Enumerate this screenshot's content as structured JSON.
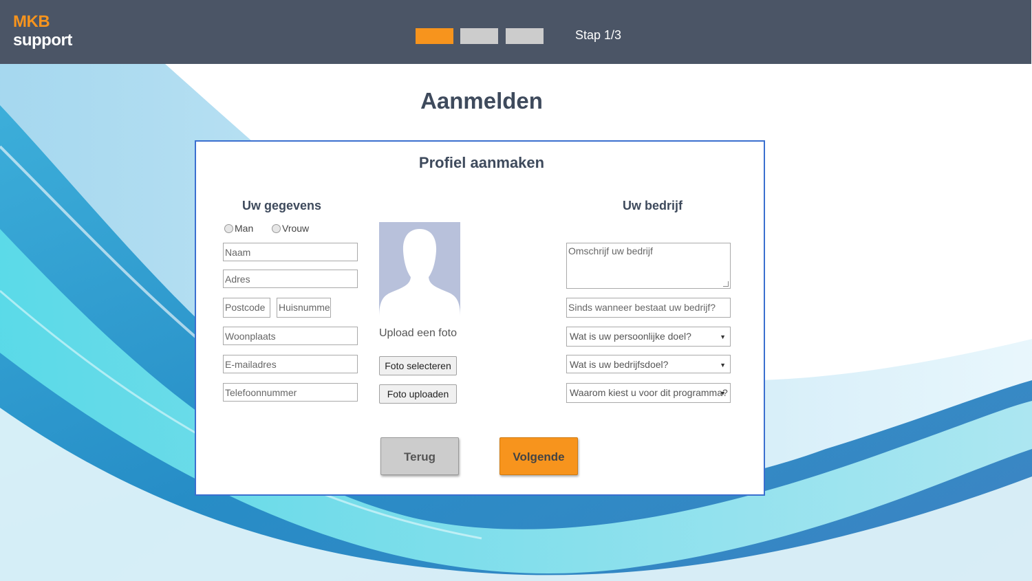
{
  "header": {
    "logo_line1": "MKB",
    "logo_line2": "support",
    "progress": {
      "current_step": 1,
      "total_steps": 3
    },
    "step_label": "Stap 1/3"
  },
  "page_title": "Aanmelden",
  "form": {
    "title": "Profiel aanmaken",
    "personal": {
      "title": "Uw gegevens",
      "gender_options": [
        "Man",
        "Vrouw"
      ],
      "fields": {
        "name": "Naam",
        "address": "Adres",
        "postcode": "Postcode",
        "house_number": "Huisnummer",
        "city": "Woonplaats",
        "email": "E-mailadres",
        "phone": "Telefoonnummer"
      }
    },
    "photo": {
      "upload_label": "Upload een foto",
      "select_button": "Foto selecteren",
      "upload_button": "Foto uploaden"
    },
    "company": {
      "title": "Uw bedrijf",
      "description": "Omschrijf uw bedrijf",
      "since": "Sinds wanneer bestaat uw bedrijf?",
      "personal_goal": "Wat is uw persoonlijke doel?",
      "company_goal": "Wat is uw bedrijfsdoel?",
      "why_program": "Waarom kiest u voor dit programma?"
    },
    "buttons": {
      "back": "Terug",
      "next": "Volgende"
    }
  },
  "colors": {
    "header_bg": "#4b5566",
    "accent": "#f7941d",
    "card_border": "#3a6fcf",
    "inactive_step": "#cccccc"
  }
}
